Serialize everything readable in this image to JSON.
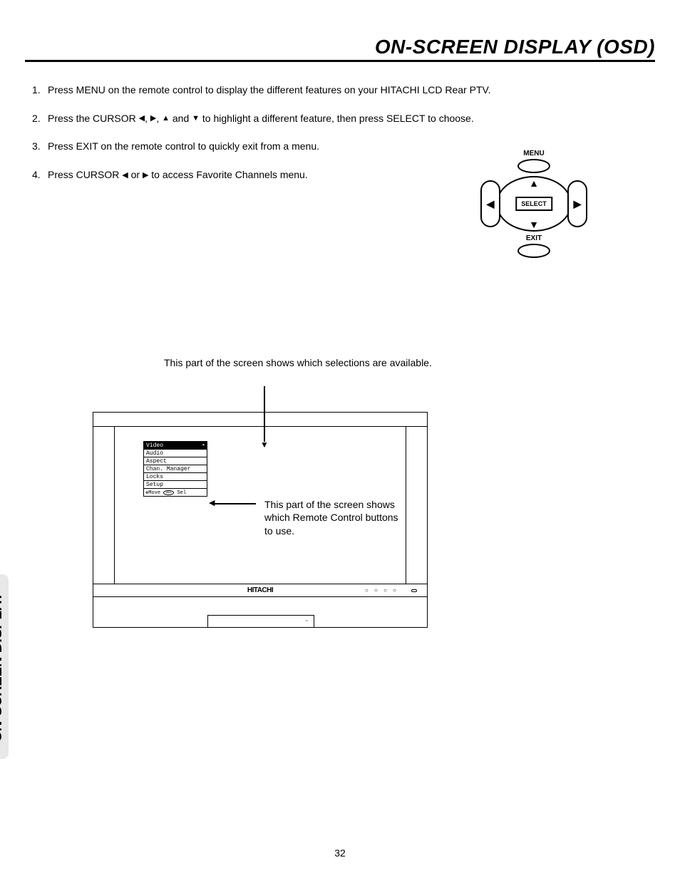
{
  "header": {
    "title": "ON-SCREEN DISPLAY (OSD)"
  },
  "instructions": [
    {
      "num": "1.",
      "text": "Press MENU on the remote control to display the different features on your HITACHI LCD Rear PTV."
    },
    {
      "num": "2.",
      "pre": "Press the CURSOR ",
      "post": " to highlight a different feature, then press SELECT to choose."
    },
    {
      "num": "3.",
      "text": "Press EXIT on the remote control to quickly exit from a menu."
    },
    {
      "num": "4.",
      "pre": "Press CURSOR ",
      "post": " to access Favorite Channels menu."
    }
  ],
  "arrows": {
    "left": "◀",
    "right": "▶",
    "up": "▲",
    "down": "▼",
    "sep": ", ",
    "and": " and ",
    "or": " or "
  },
  "remote": {
    "menu": "MENU",
    "select": "SELECT",
    "exit": "EXIT"
  },
  "callouts": {
    "top": "This part of the screen shows which selections are available.",
    "right": "This part of the screen shows which Remote Control buttons to use."
  },
  "osd_menu": {
    "items": [
      "Video",
      "Audio",
      "Aspect",
      "Chan. Manager",
      "Locks",
      "Setup"
    ],
    "selected_index": 0,
    "hint_move": "Move",
    "hint_sel_badge": "SEL",
    "hint_sel": "Sel"
  },
  "tv": {
    "brand": "HITACHI",
    "dots": "○ ○ ○ ○"
  },
  "sidebar": {
    "label": "ON-SCREEN DISPLAY"
  },
  "page_number": "32"
}
